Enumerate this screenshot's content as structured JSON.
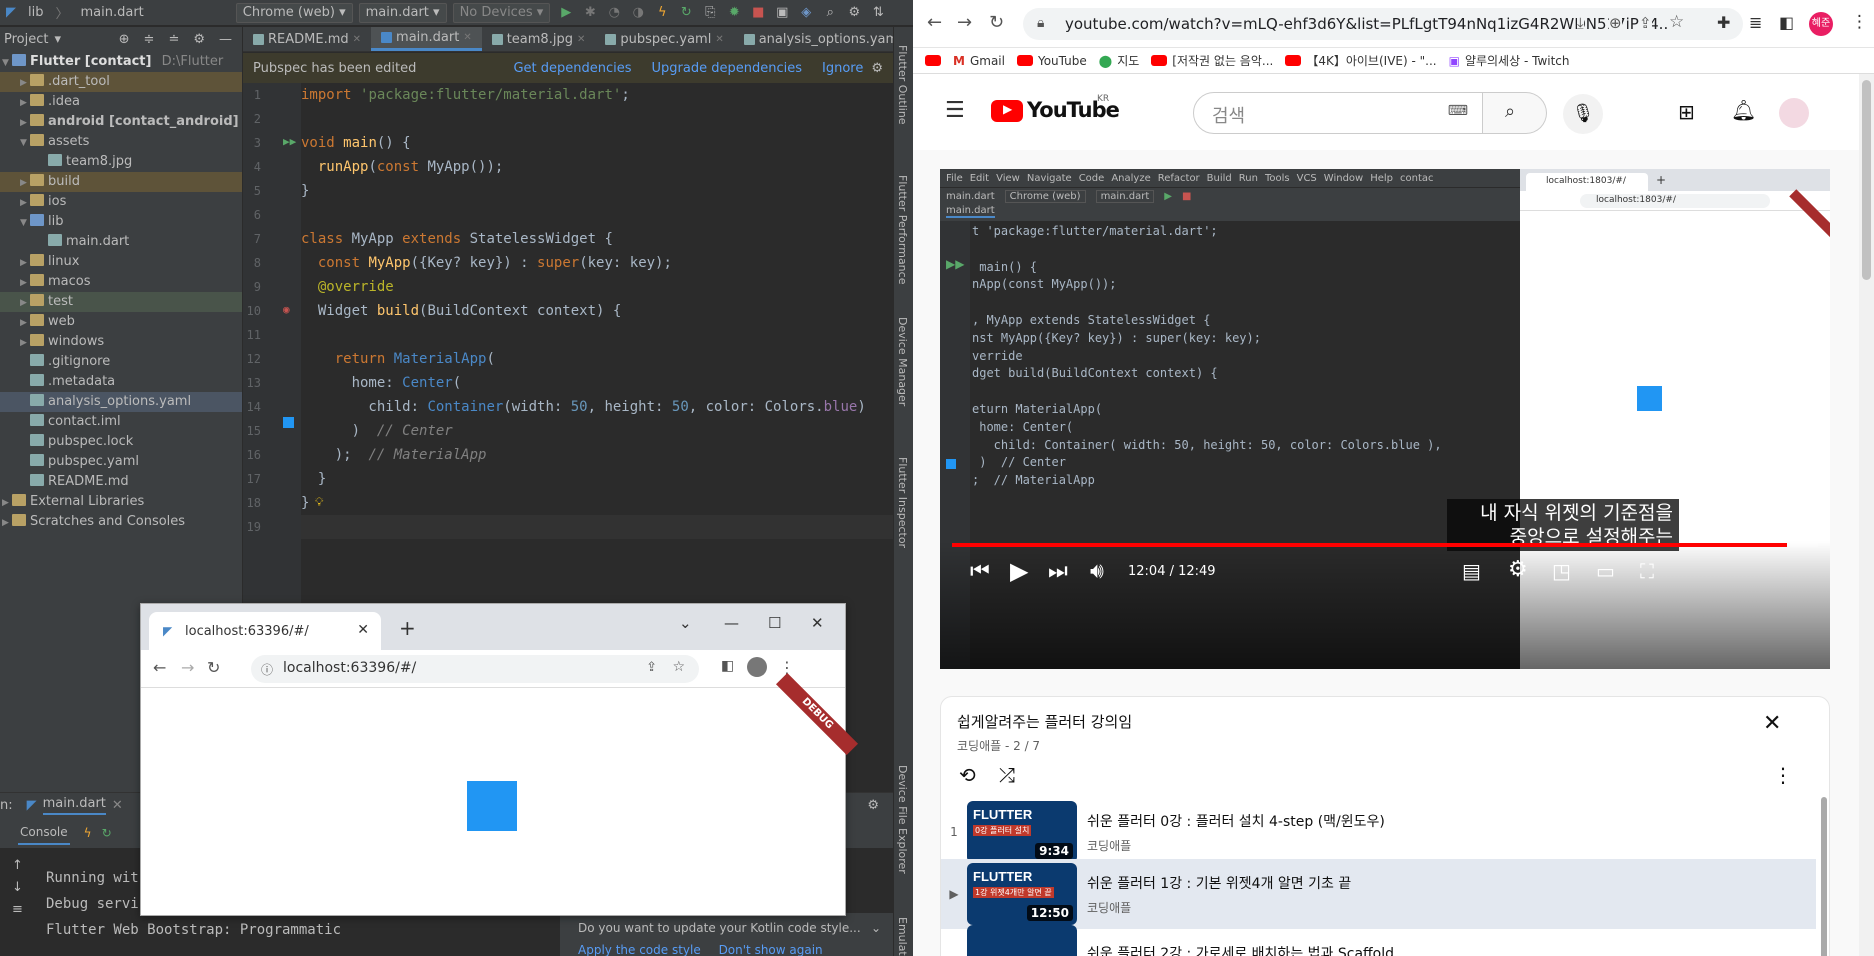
{
  "ide": {
    "breadcrumb": [
      "lib",
      "main.dart"
    ],
    "device_target": "Chrome (web)",
    "run_config": "main.dart",
    "devices": "No Devices",
    "project_label": "Project",
    "project_root": "Flutter [contact]",
    "project_path": "D:\\Flutter",
    "tree": [
      {
        "label": ".dart_tool",
        "type": "folder",
        "depth": 1,
        "expanded": false,
        "highlight": "excluded"
      },
      {
        "label": ".idea",
        "type": "folder",
        "depth": 1,
        "expanded": false
      },
      {
        "label": "android [contact_android]",
        "type": "folder",
        "depth": 1,
        "expanded": false,
        "bold": true
      },
      {
        "label": "assets",
        "type": "folder",
        "depth": 1,
        "expanded": true
      },
      {
        "label": "team8.jpg",
        "type": "file",
        "depth": 2
      },
      {
        "label": "build",
        "type": "folder",
        "depth": 1,
        "expanded": false,
        "highlight": "excluded"
      },
      {
        "label": "ios",
        "type": "folder",
        "depth": 1,
        "expanded": false
      },
      {
        "label": "lib",
        "type": "folder",
        "depth": 1,
        "expanded": true,
        "color": "blue"
      },
      {
        "label": "main.dart",
        "type": "file",
        "depth": 2
      },
      {
        "label": "linux",
        "type": "folder",
        "depth": 1,
        "expanded": false
      },
      {
        "label": "macos",
        "type": "folder",
        "depth": 1,
        "expanded": false
      },
      {
        "label": "test",
        "type": "folder",
        "depth": 1,
        "expanded": false,
        "highlight": "test"
      },
      {
        "label": "web",
        "type": "folder",
        "depth": 1,
        "expanded": false
      },
      {
        "label": "windows",
        "type": "folder",
        "depth": 1,
        "expanded": false
      },
      {
        "label": ".gitignore",
        "type": "file",
        "depth": 1
      },
      {
        "label": ".metadata",
        "type": "file",
        "depth": 1
      },
      {
        "label": "analysis_options.yaml",
        "type": "file",
        "depth": 1,
        "highlight": "selected"
      },
      {
        "label": "contact.iml",
        "type": "file",
        "depth": 1
      },
      {
        "label": "pubspec.lock",
        "type": "file",
        "depth": 1
      },
      {
        "label": "pubspec.yaml",
        "type": "file",
        "depth": 1
      },
      {
        "label": "README.md",
        "type": "file",
        "depth": 1
      },
      {
        "label": "External Libraries",
        "type": "folder",
        "depth": 0,
        "expanded": false
      },
      {
        "label": "Scratches and Consoles",
        "type": "folder",
        "depth": 0,
        "expanded": false
      }
    ],
    "editor_tabs": [
      "README.md",
      "main.dart",
      "team8.jpg",
      "pubspec.yaml",
      "analysis_options.yaml"
    ],
    "active_tab": 1,
    "pubspec_banner": {
      "message": "Pubspec has been edited",
      "actions": [
        "Get dependencies",
        "Upgrade dependencies",
        "Ignore"
      ]
    },
    "line_numbers": [
      "1",
      "2",
      "3",
      "4",
      "5",
      "6",
      "7",
      "8",
      "9",
      "10",
      "11",
      "12",
      "13",
      "14",
      "15",
      "16",
      "17",
      "18",
      "19"
    ],
    "code_lines": [
      [
        [
          "kw",
          "import "
        ],
        [
          "st",
          "'package:flutter/material.dart'"
        ],
        [
          "",
          "; "
        ]
      ],
      [],
      [
        [
          "kw",
          "void "
        ],
        [
          "fn",
          "main"
        ],
        [
          "",
          "() {"
        ]
      ],
      [
        [
          "",
          "  "
        ],
        [
          "fn",
          "runApp"
        ],
        [
          "",
          "("
        ],
        [
          "kw",
          "const "
        ],
        [
          "",
          "MyApp());"
        ]
      ],
      [
        [
          "",
          "}"
        ]
      ],
      [],
      [
        [
          "kw",
          "class "
        ],
        [
          "",
          "MyApp "
        ],
        [
          "kw",
          "extends "
        ],
        [
          "",
          "StatelessWidget {"
        ]
      ],
      [
        [
          "",
          "  "
        ],
        [
          "kw",
          "const "
        ],
        [
          "fn",
          "MyApp"
        ],
        [
          "",
          "({Key? key}) : "
        ],
        [
          "kw",
          "super"
        ],
        [
          "",
          "(key: key);"
        ]
      ],
      [
        [
          "",
          "  "
        ],
        [
          "an",
          "@override"
        ]
      ],
      [
        [
          "",
          "  Widget "
        ],
        [
          "fn",
          "build"
        ],
        [
          "",
          "(BuildContext context) {"
        ]
      ],
      [],
      [
        [
          "",
          "    "
        ],
        [
          "kw",
          "return "
        ],
        [
          "ty",
          "MaterialApp"
        ],
        [
          "",
          "("
        ]
      ],
      [
        [
          "",
          "      home: "
        ],
        [
          "ty",
          "Center"
        ],
        [
          "",
          "("
        ]
      ],
      [
        [
          "",
          "        child: "
        ],
        [
          "ty",
          "Container"
        ],
        [
          "",
          "(width: "
        ],
        [
          "cn",
          "50"
        ],
        [
          "",
          ", height: "
        ],
        [
          "cn",
          "50"
        ],
        [
          "",
          ", color: Colors."
        ],
        [
          "pm",
          "blue"
        ],
        [
          "",
          ")"
        ]
      ],
      [
        [
          "",
          "      )  "
        ],
        [
          "cm",
          "// Center"
        ]
      ],
      [
        [
          "",
          "    );  "
        ],
        [
          "cm",
          "// MaterialApp"
        ]
      ],
      [
        [
          "",
          "  }"
        ]
      ],
      [
        [
          "",
          "}"
        ]
      ],
      []
    ],
    "right_tool_windows": [
      "Flutter Outline",
      "Flutter Performance",
      "Device Manager",
      "Flutter Inspector",
      "Device File Explorer",
      "Emulator"
    ],
    "run_tab": "main.dart",
    "run_prefix": "n:",
    "console_label": "Console",
    "console_lines": [
      "Running wit",
      "Debug servic",
      "Flutter Web Bootstrap: Programmatic"
    ],
    "kotlin_notification": {
      "message": "Do you want to update your Kotlin code style...",
      "actions": [
        "Apply the code style",
        "Don't show again"
      ]
    }
  },
  "popup_browser": {
    "tab_title": "localhost:63396/#/",
    "url": "localhost:63396/#/",
    "debug_banner": "DEBUG",
    "box_color": "#2196f3"
  },
  "chrome": {
    "url": "youtube.com/watch?v=mLQ-ehf3d6Y&list=PLfLgtT94nNq1izG4R2WDN517iPX4...",
    "bookmarks": [
      "Gmail",
      "YouTube",
      "지도",
      "[저작권 없는 음악...",
      "【4K】아이브(IVE) - \"...",
      "얄루의세상 - Twitch"
    ],
    "profile_initials": "혜준",
    "youtube": {
      "logo": "YouTube",
      "region": "KR",
      "search_placeholder": "검색",
      "player": {
        "subtitle_line1": "내 자식 위젯의 기준점을",
        "subtitle_line2": "중앙으로 설정해주는 Center()",
        "time": "12:04 / 12:49",
        "progress": 0.964,
        "video_menu": [
          "File",
          "Edit",
          "View",
          "Navigate",
          "Code",
          "Analyze",
          "Refactor",
          "Build",
          "Run",
          "Tools",
          "VCS",
          "Window",
          "Help",
          "contac"
        ],
        "video_tab": "main.dart",
        "video_combo1": "Chrome (web)",
        "video_combo2": "main.dart",
        "video_tab2": "main.dart",
        "video_code": [
          "t 'package:flutter/material.dart';",
          "",
          " main() {",
          "nApp(const MyApp());",
          "",
          ", MyApp extends StatelessWidget {",
          "nst MyApp({Key? key}) : super(key: key);",
          "verride",
          "dget build(BuildContext context) {",
          "",
          "eturn MaterialApp(",
          " home: Center(",
          "   child: Container( width: 50, height: 50, color: Colors.blue ),",
          " )  // Center",
          ";  // MaterialApp"
        ],
        "video_browser_tab": "localhost:1803/#/",
        "video_browser_url": "localhost:1803/#/"
      },
      "playlist": {
        "title": "쉽게알려주는 플러터 강의임",
        "meta": "코딩애플 - 2 / 7",
        "items": [
          {
            "index": "1",
            "title": "쉬운 플러터 0강 : 플러터 설치 4-step (맥/윈도우)",
            "channel": "코딩애플",
            "duration": "9:34",
            "thumb_caption": "0강 플러터 설치",
            "thumb_logo": "FLUTTER"
          },
          {
            "index": "▶",
            "title": "쉬운 플러터 1강 : 기본 위젯4개 알면 기초 끝",
            "channel": "코딩애플",
            "duration": "12:50",
            "thumb_caption": "1강 위젯4개만 알면 끝",
            "thumb_logo": "FLUTTER"
          },
          {
            "index": "",
            "title": "쉬운 플러터 2강 : 가로세로 배치하는 법과 Scaffold",
            "channel": "",
            "duration": "",
            "thumb_caption": "",
            "thumb_logo": ""
          }
        ]
      }
    }
  }
}
